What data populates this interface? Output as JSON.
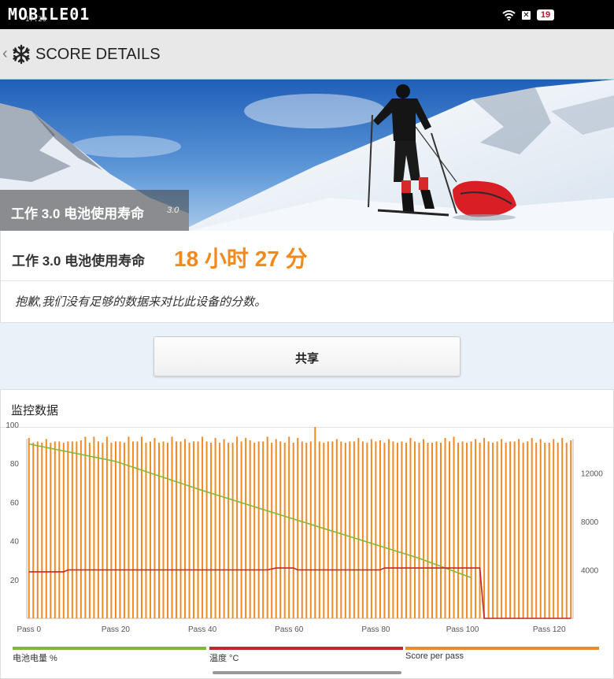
{
  "status_bar": {
    "brand": "MOBILE01",
    "time": "17:20",
    "battery": "19"
  },
  "header": {
    "title": "SCORE DETAILS"
  },
  "hero": {
    "label": "工作 3.0 电池使用寿命",
    "version": "3.0"
  },
  "score": {
    "label": "工作 3.0 电池使用寿命",
    "value": "18 小时 27 分",
    "note": "抱歉,我们没有足够的数据来对比此设备的分数。"
  },
  "share": {
    "label": "共享"
  },
  "monitor": {
    "title": "监控数据"
  },
  "legend": [
    {
      "label": "电池电量 %",
      "color": "#7dbb33"
    },
    {
      "label": "温度 °C",
      "color": "#c0282d"
    },
    {
      "label": "Score per pass",
      "color": "#f08a24"
    }
  ],
  "chart_data": {
    "type": "bar",
    "left_axis_ticks": [
      "100",
      "80",
      "60",
      "40",
      "20"
    ],
    "right_axis_ticks": [
      "12000",
      "8000",
      "4000"
    ],
    "x_ticks": [
      "Pass 0",
      "Pass 20",
      "Pass 40",
      "Pass 60",
      "Pass 80",
      "Pass 100",
      "Pass 120"
    ],
    "ylim_left": [
      0,
      100
    ],
    "ylim_right": [
      0,
      16000
    ],
    "passes": 126,
    "series": [
      {
        "name": "电池电量 %",
        "axis": "left",
        "type": "line",
        "points": [
          [
            0,
            90
          ],
          [
            20,
            81
          ],
          [
            40,
            66
          ],
          [
            60,
            52
          ],
          [
            80,
            38
          ],
          [
            90,
            31
          ],
          [
            102,
            21
          ]
        ]
      },
      {
        "name": "温度 °C",
        "axis": "left",
        "type": "line",
        "points": [
          [
            0,
            24
          ],
          [
            8,
            24
          ],
          [
            9,
            25
          ],
          [
            55,
            25
          ],
          [
            57,
            26
          ],
          [
            61,
            26
          ],
          [
            62,
            25
          ],
          [
            81,
            25
          ],
          [
            82,
            26
          ],
          [
            104,
            26
          ],
          [
            105,
            0
          ],
          [
            125,
            0
          ]
        ]
      },
      {
        "name": "Score per pass",
        "axis": "right",
        "type": "bar",
        "values": [
          14900,
          14500,
          14600,
          14500,
          14800,
          14500,
          14600,
          14600,
          14500,
          14600,
          14600,
          14600,
          14700,
          15000,
          14500,
          15000,
          14600,
          14500,
          15000,
          14500,
          14600,
          14600,
          14500,
          15000,
          14600,
          14600,
          15000,
          14500,
          14600,
          14900,
          14500,
          14600,
          14500,
          15000,
          14600,
          14600,
          14800,
          14500,
          14600,
          14600,
          15000,
          14600,
          14500,
          14900,
          14500,
          14800,
          14500,
          14500,
          15000,
          14600,
          14900,
          14700,
          14500,
          14600,
          14600,
          15000,
          14500,
          14800,
          14600,
          14500,
          15000,
          14500,
          14900,
          14600,
          14500,
          14600,
          15800,
          14600,
          14500,
          14600,
          14600,
          14800,
          14600,
          14500,
          14600,
          14600,
          14900,
          14600,
          14500,
          14800,
          14600,
          14700,
          14500,
          14800,
          14600,
          14500,
          14600,
          14500,
          14900,
          14600,
          14500,
          14800,
          14500,
          14500,
          14600,
          14500,
          14900,
          14600,
          15000,
          14500,
          14600,
          14500,
          14600,
          14800,
          14500,
          14900,
          14600,
          14500,
          14600,
          14800,
          14500,
          14600,
          14600,
          14800,
          14500,
          14600,
          14900,
          14500,
          14800,
          14500,
          14500,
          14800,
          14500,
          14900,
          14500,
          14700
        ]
      }
    ]
  }
}
